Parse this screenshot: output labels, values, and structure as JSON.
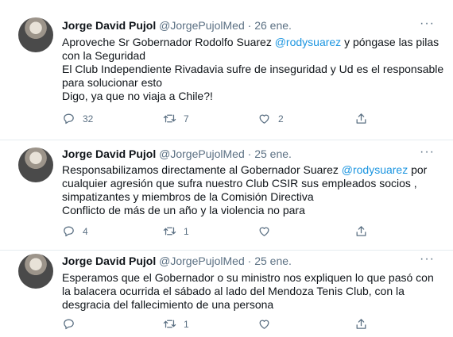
{
  "tweets": [
    {
      "author_name": "Jorge David Pujol",
      "handle": "@JorgePujolMed",
      "separator": "·",
      "date": "26 ene.",
      "more": "···",
      "lines": [
        {
          "before": "Aproveche Sr Gobernador Rodolfo Suarez ",
          "mention": "@rodysuarez",
          "after": " y póngase las pilas"
        },
        {
          "before": "con la Seguridad",
          "mention": "",
          "after": ""
        },
        {
          "before": "El Club Independiente Rivadavia sufre de inseguridad y Ud es el responsable",
          "mention": "",
          "after": ""
        },
        {
          "before": "para solucionar esto",
          "mention": "",
          "after": ""
        },
        {
          "before": "Digo, ya que no viaja a Chile?!",
          "mention": "",
          "after": ""
        }
      ],
      "replies": "32",
      "retweets": "7",
      "likes": "2"
    },
    {
      "author_name": "Jorge David Pujol",
      "handle": "@JorgePujolMed",
      "separator": "·",
      "date": "25 ene.",
      "more": "···",
      "lines": [
        {
          "before": "Responsabilizamos directamente al Gobernador Suarez ",
          "mention": "@rodysuarez",
          "after": " por"
        },
        {
          "before": "cualquier agresión que sufra nuestro Club CSIR sus empleados  socios ,",
          "mention": "",
          "after": ""
        },
        {
          "before": " simpatizantes y miembros de la Comisión Directiva",
          "mention": "",
          "after": ""
        },
        {
          "before": "Conflicto de más de un año  y la violencia no para",
          "mention": "",
          "after": ""
        }
      ],
      "replies": "4",
      "retweets": "1",
      "likes": ""
    },
    {
      "author_name": "Jorge David Pujol",
      "handle": "@JorgePujolMed",
      "separator": "·",
      "date": "25 ene.",
      "more": "···",
      "lines": [
        {
          "before": "Esperamos que el Gobernador o su ministro nos expliquen lo que pasó con",
          "mention": "",
          "after": ""
        },
        {
          "before": "la balacera ocurrida el sábado al lado del Mendoza Tenis Club, con la",
          "mention": "",
          "after": ""
        },
        {
          "before": "desgracia del fallecimiento de una persona",
          "mention": "",
          "after": ""
        }
      ],
      "replies": "",
      "retweets": "1",
      "likes": ""
    }
  ],
  "colors": {
    "text": "#0f1419",
    "muted": "#5b7083",
    "link": "#1b95e0",
    "divider": "#e6ecf0"
  },
  "icons": {
    "reply": "reply-icon",
    "retweet": "retweet-icon",
    "like": "heart-icon",
    "share": "share-icon",
    "more": "more-options-icon"
  }
}
